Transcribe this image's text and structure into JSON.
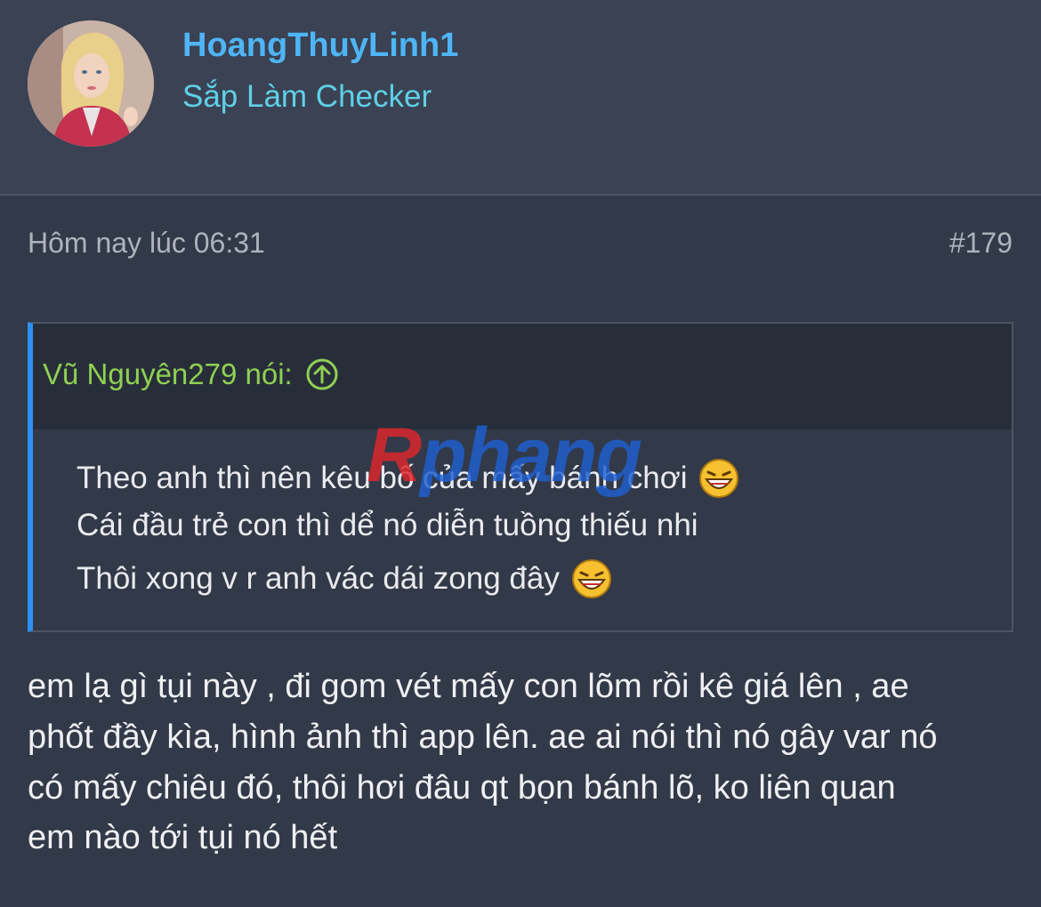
{
  "user": {
    "name": "HoangThuyLinh1",
    "title": "Sắp Làm Checker"
  },
  "post": {
    "time": "Hôm nay lúc 06:31",
    "number": "#179"
  },
  "quote": {
    "author": "Vũ Nguyên279 nói:",
    "lines": [
      "Theo anh thì nên kêu bố của mấy bánh chơi",
      "Cái đầu trẻ con thì dể nó diễn tuồng thiếu nhi",
      "Thôi xong v r anh vác dái zong đây"
    ]
  },
  "watermark": {
    "first": "R",
    "rest": "phang"
  },
  "body": {
    "lines": [
      "em lạ gì tụi này , đi gom vét mấy con lõm rồi kê giá lên , ae",
      "phốt đầy kìa, hình ảnh thì app lên. ae ai nói thì nó gây var nó",
      "có mấy chiêu đó, thôi hơi đâu qt bọn bánh lõ, ko liên quan",
      "em nào tới tụi nó hết"
    ]
  },
  "colors": {
    "background": "#323948",
    "username": "#4fb5f5",
    "user_title": "#5fd0e6",
    "quote_author": "#8fd053",
    "quote_bar": "#2d8ff2"
  },
  "icons": {
    "quote_jump": "arrow-up-circle-icon",
    "emoji": "laughing-emoji-icon"
  }
}
